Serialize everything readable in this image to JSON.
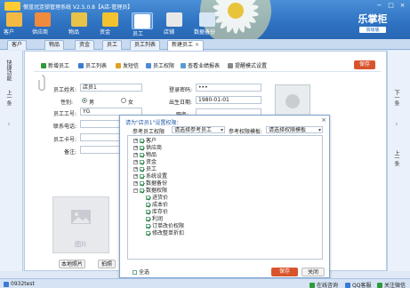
{
  "window": {
    "title": "傲蓝冠连锁管理系统 V2.5.0.8【A店-管理员】",
    "controls": [
      "−",
      "□",
      "×"
    ]
  },
  "nav": [
    {
      "label": "客户",
      "icon": "customer-icon",
      "color": "#f4b942"
    },
    {
      "label": "供应商",
      "icon": "supplier-icon",
      "color": "#f08a3c"
    },
    {
      "label": "物品",
      "icon": "goods-icon",
      "color": "#e7c34a"
    },
    {
      "label": "资金",
      "icon": "money-icon",
      "color": "#f2c230"
    },
    {
      "label": "员工",
      "icon": "employee-icon",
      "color": "#ffffff",
      "active": true
    },
    {
      "label": "店铺",
      "icon": "store-icon",
      "color": "#e8e8e8"
    },
    {
      "label": "数据备份",
      "icon": "backup-icon",
      "color": "#d6e6f7"
    }
  ],
  "brand": {
    "main": "乐掌柜",
    "sub": "高级版"
  },
  "tabs": [
    {
      "label": "客户"
    },
    {
      "label": "物品"
    },
    {
      "label": "资金"
    },
    {
      "label": "员工"
    },
    {
      "label": "员工列表"
    },
    {
      "label": "新建员工",
      "active": true
    }
  ],
  "left_panel": {
    "title": "快捷功能",
    "sub": "上一条"
  },
  "right_panel": {
    "title": "下一条",
    "sub": "上一条"
  },
  "toolbar": {
    "items": [
      {
        "label": "新增员工",
        "icon": "add-icon",
        "color": "#2e9a3a"
      },
      {
        "label": "员工列表",
        "icon": "list-icon",
        "color": "#3b7bd0"
      },
      {
        "label": "发短信",
        "icon": "sms-icon",
        "color": "#e0a020"
      },
      {
        "label": "员工权限",
        "icon": "key-icon",
        "color": "#4a8ad8"
      },
      {
        "label": "查看业绩报表",
        "icon": "report-icon",
        "color": "#5a9ad0"
      },
      {
        "label": "提醒模式设置",
        "icon": "gear-icon",
        "color": "#888888"
      }
    ],
    "save": "保存"
  },
  "form": {
    "name_label": "员工姓名:",
    "name_value": "店员1",
    "gender_label": "性别:",
    "gender_options": [
      "男",
      "女"
    ],
    "gender_selected": "男",
    "id_label": "员工工号:",
    "id_value": "YG",
    "phone_label": "联系电话:",
    "card_label": "员工卡号:",
    "remark_label": "备注:",
    "pwd_label": "登录密码:",
    "pwd_value": "•••",
    "birth_label": "出生日期:",
    "birth_value": "1980-01-01",
    "role_label": "职务:",
    "photo_btn": "本地照片",
    "camera_btn": "拍照",
    "photo_placeholder": "图片"
  },
  "dialog": {
    "title": "请为\"店员1\"设置权限：",
    "ref_emp_label": "参考员工权限",
    "ref_emp_value": "请选择参考员工",
    "ref_tpl_label": "参考权限模板:",
    "ref_tpl_value": "请选择权限模板",
    "tree": [
      {
        "label": "客户",
        "level": 0,
        "expand": "+",
        "checked": true
      },
      {
        "label": "供应商",
        "level": 0,
        "expand": "+",
        "checked": true
      },
      {
        "label": "物品",
        "level": 0,
        "expand": "+",
        "checked": true
      },
      {
        "label": "资金",
        "level": 0,
        "expand": "+",
        "checked": true
      },
      {
        "label": "员工",
        "level": 0,
        "expand": "+",
        "checked": true
      },
      {
        "label": "系统设置",
        "level": 0,
        "expand": "+",
        "checked": true
      },
      {
        "label": "数据备份",
        "level": 0,
        "expand": "+",
        "checked": true
      },
      {
        "label": "数据权限",
        "level": 0,
        "expand": "−",
        "checked": true
      },
      {
        "label": "进货价",
        "level": 1,
        "checked": true
      },
      {
        "label": "成本价",
        "level": 1,
        "checked": true
      },
      {
        "label": "库存价",
        "level": 1,
        "checked": true
      },
      {
        "label": "利润",
        "level": 1,
        "checked": true
      },
      {
        "label": "订单改价权限",
        "level": 1,
        "checked": true
      },
      {
        "label": "修改整单折扣",
        "level": 1,
        "checked": true
      }
    ],
    "select_all": "全选",
    "save": "保存",
    "close": "关闭"
  },
  "status": {
    "user": "0932test",
    "items": [
      {
        "label": "在线咨询",
        "icon": "chat-icon",
        "color": "#2e9a3a"
      },
      {
        "label": "QQ客服",
        "icon": "qq-icon",
        "color": "#3a7bd5"
      },
      {
        "label": "关注微信",
        "icon": "wechat-icon",
        "color": "#2e9a3a"
      }
    ]
  }
}
